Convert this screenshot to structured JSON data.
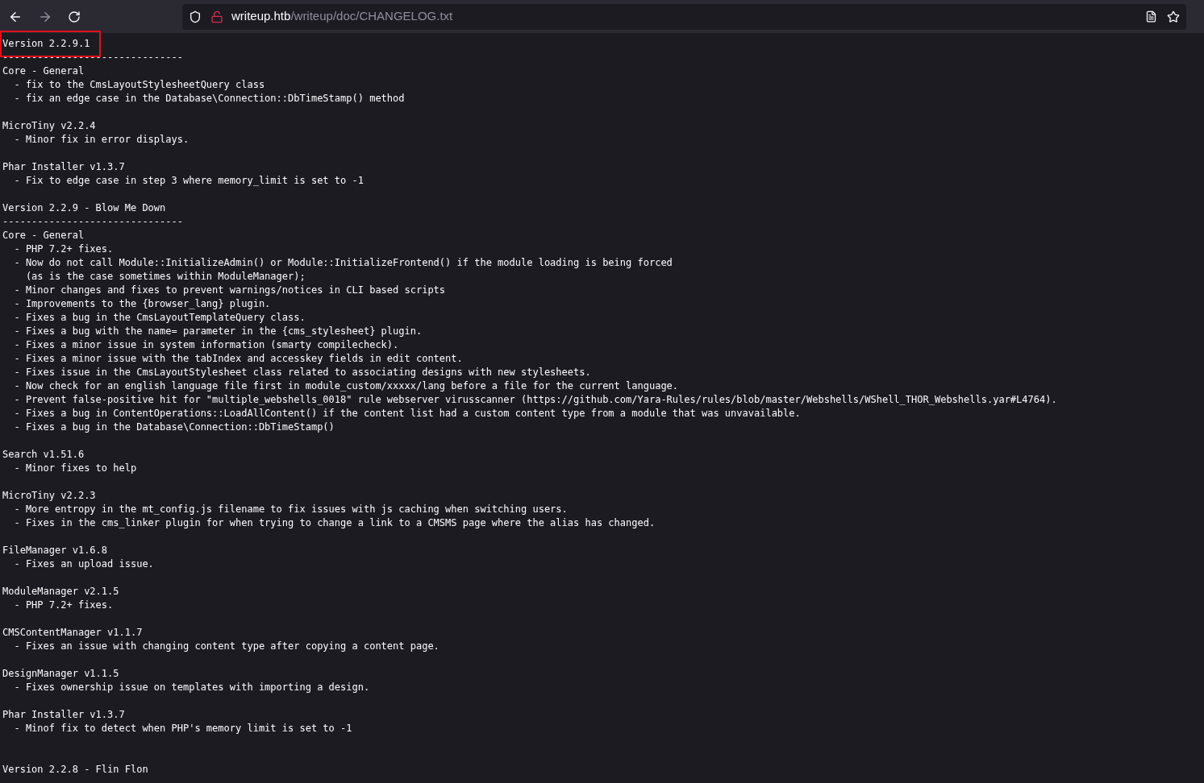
{
  "toolbar": {
    "url": {
      "host": "writeup.htb",
      "path": "/writeup/doc/CHANGELOG.txt"
    },
    "forward_disabled": true
  },
  "document": {
    "lines": [
      {
        "kind": "text",
        "text": "Version 2.2.9.1",
        "highlighted": true
      },
      {
        "kind": "text",
        "text": "-------------------------------",
        "highlighted": false
      },
      {
        "kind": "text",
        "text": "Core - General",
        "highlighted": false
      },
      {
        "kind": "text",
        "text": "  - fix to the CmsLayoutStylesheetQuery class",
        "highlighted": false
      },
      {
        "kind": "text",
        "text": "  - fix an edge case in the Database\\Connection::DbTimeStamp() method",
        "highlighted": false
      },
      {
        "kind": "blank"
      },
      {
        "kind": "text",
        "text": "MicroTiny v2.2.4",
        "highlighted": false
      },
      {
        "kind": "text",
        "text": "  - Minor fix in error displays.",
        "highlighted": false
      },
      {
        "kind": "blank"
      },
      {
        "kind": "text",
        "text": "Phar Installer v1.3.7",
        "highlighted": false
      },
      {
        "kind": "text",
        "text": "  - Fix to edge case in step 3 where memory_limit is set to -1",
        "highlighted": false
      },
      {
        "kind": "blank"
      },
      {
        "kind": "text",
        "text": "Version 2.2.9 - Blow Me Down",
        "highlighted": false
      },
      {
        "kind": "text",
        "text": "-------------------------------",
        "highlighted": false
      },
      {
        "kind": "text",
        "text": "Core - General",
        "highlighted": false
      },
      {
        "kind": "text",
        "text": "  - PHP 7.2+ fixes.",
        "highlighted": false
      },
      {
        "kind": "text",
        "text": "  - Now do not call Module::InitializeAdmin() or Module::InitializeFrontend() if the module loading is being forced",
        "highlighted": false
      },
      {
        "kind": "text",
        "text": "    (as is the case sometimes within ModuleManager);",
        "highlighted": false
      },
      {
        "kind": "text",
        "text": "  - Minor changes and fixes to prevent warnings/notices in CLI based scripts",
        "highlighted": false
      },
      {
        "kind": "text",
        "text": "  - Improvements to the {browser_lang} plugin.",
        "highlighted": false
      },
      {
        "kind": "text",
        "text": "  - Fixes a bug in the CmsLayoutTemplateQuery class.",
        "highlighted": false
      },
      {
        "kind": "text",
        "text": "  - Fixes a bug with the name= parameter in the {cms_stylesheet} plugin.",
        "highlighted": false
      },
      {
        "kind": "text",
        "text": "  - Fixes a minor issue in system information (smarty compilecheck).",
        "highlighted": false
      },
      {
        "kind": "text",
        "text": "  - Fixes a minor issue with the tabIndex and accesskey fields in edit content.",
        "highlighted": false
      },
      {
        "kind": "text",
        "text": "  - Fixes issue in the CmsLayoutStylesheet class related to associating designs with new stylesheets.",
        "highlighted": false
      },
      {
        "kind": "text",
        "text": "  - Now check for an english language file first in module_custom/xxxxx/lang before a file for the current language.",
        "highlighted": false
      },
      {
        "kind": "text",
        "text": "  - Prevent false-positive hit for \"multiple_webshells_0018\" rule webserver virusscanner (https://github.com/Yara-Rules/rules/blob/master/Webshells/WShell_THOR_Webshells.yar#L4764).",
        "highlighted": false
      },
      {
        "kind": "text",
        "text": "  - Fixes a bug in ContentOperations::LoadAllContent() if the content list had a custom content type from a module that was unvavailable.",
        "highlighted": false
      },
      {
        "kind": "text",
        "text": "  - Fixes a bug in the Database\\Connection::DbTimeStamp()",
        "highlighted": false
      },
      {
        "kind": "blank"
      },
      {
        "kind": "text",
        "text": "Search v1.51.6",
        "highlighted": false
      },
      {
        "kind": "text",
        "text": "  - Minor fixes to help",
        "highlighted": false
      },
      {
        "kind": "blank"
      },
      {
        "kind": "text",
        "text": "MicroTiny v2.2.3",
        "highlighted": false
      },
      {
        "kind": "text",
        "text": "  - More entropy in the mt_config.js filename to fix issues with js caching when switching users.",
        "highlighted": false
      },
      {
        "kind": "text",
        "text": "  - Fixes in the cms_linker plugin for when trying to change a link to a CMSMS page where the alias has changed.",
        "highlighted": false
      },
      {
        "kind": "blank"
      },
      {
        "kind": "text",
        "text": "FileManager v1.6.8",
        "highlighted": false
      },
      {
        "kind": "text",
        "text": "  - Fixes an upload issue.",
        "highlighted": false
      },
      {
        "kind": "blank"
      },
      {
        "kind": "text",
        "text": "ModuleManager v2.1.5",
        "highlighted": false
      },
      {
        "kind": "text",
        "text": "  - PHP 7.2+ fixes.",
        "highlighted": false
      },
      {
        "kind": "blank"
      },
      {
        "kind": "text",
        "text": "CMSContentManager v1.1.7",
        "highlighted": false
      },
      {
        "kind": "text",
        "text": "  - Fixes an issue with changing content type after copying a content page.",
        "highlighted": false
      },
      {
        "kind": "blank"
      },
      {
        "kind": "text",
        "text": "DesignManager v1.1.5",
        "highlighted": false
      },
      {
        "kind": "text",
        "text": "  - Fixes ownership issue on templates with importing a design.",
        "highlighted": false
      },
      {
        "kind": "blank"
      },
      {
        "kind": "text",
        "text": "Phar Installer v1.3.7",
        "highlighted": false
      },
      {
        "kind": "text",
        "text": "  - Minof fix to detect when PHP's memory limit is set to -1",
        "highlighted": false
      },
      {
        "kind": "blank"
      },
      {
        "kind": "blank"
      },
      {
        "kind": "text",
        "text": "Version 2.2.8 - Flin Flon",
        "highlighted": false
      }
    ]
  }
}
